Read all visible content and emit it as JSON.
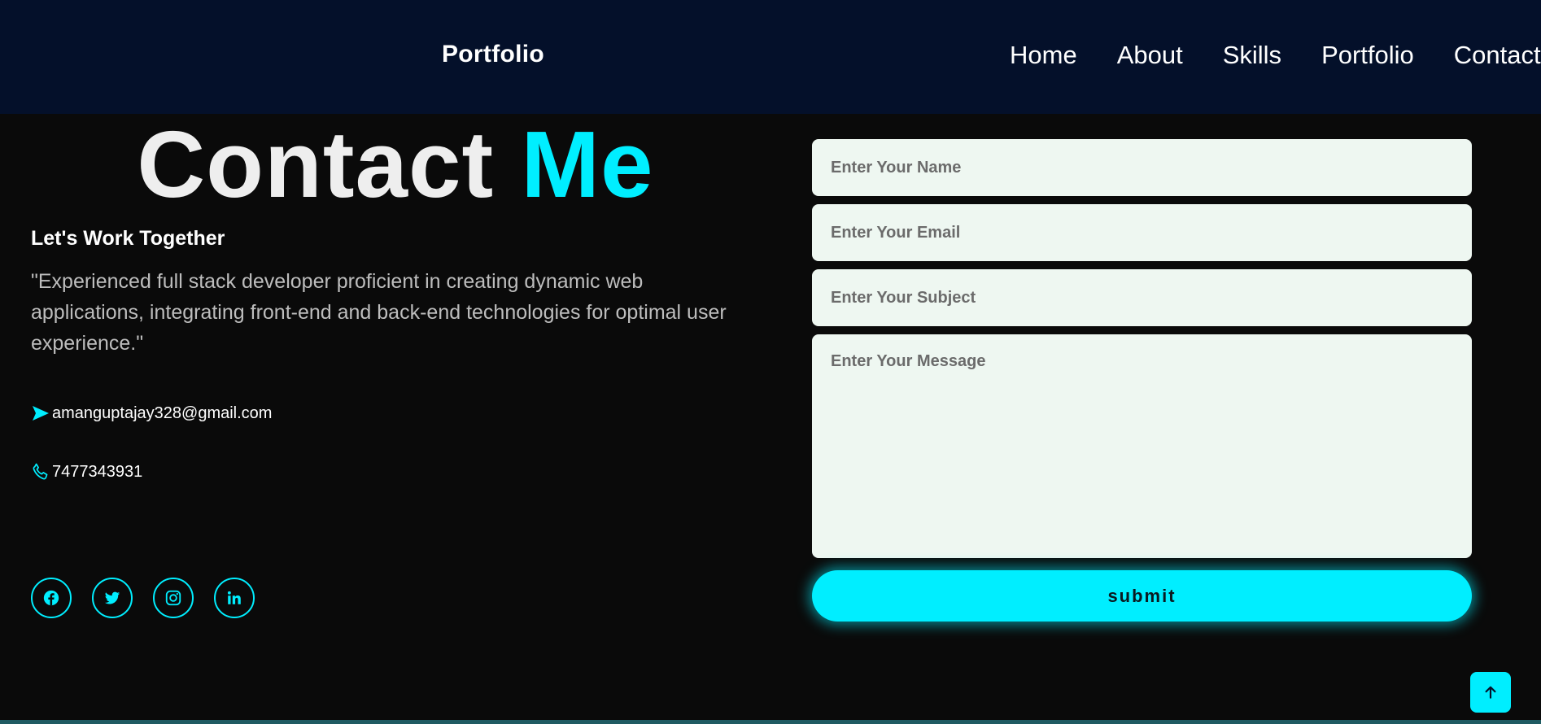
{
  "navbar": {
    "brand": "Portfolio",
    "links": [
      {
        "label": "Home"
      },
      {
        "label": "About"
      },
      {
        "label": "Skills"
      },
      {
        "label": "Portfolio"
      },
      {
        "label": "Contact"
      }
    ]
  },
  "contact": {
    "title_part1": "Contact",
    "title_part2": "Me",
    "subheading": "Let's Work Together",
    "description": "\"Experienced full stack developer proficient in creating dynamic web applications, integrating front-end and back-end technologies for optimal user experience.\"",
    "email": {
      "icon": "send-icon",
      "value": "amanguptajay328@gmail.com"
    },
    "phone": {
      "icon": "phone-icon",
      "value": "7477343931"
    },
    "socials": [
      {
        "icon": "facebook-icon"
      },
      {
        "icon": "twitter-icon"
      },
      {
        "icon": "instagram-icon"
      },
      {
        "icon": "linkedin-icon"
      }
    ]
  },
  "form": {
    "name_placeholder": "Enter Your Name",
    "email_placeholder": "Enter Your Email",
    "subject_placeholder": "Enter Your Subject",
    "message_placeholder": "Enter Your Message",
    "submit_label": "submit"
  },
  "scroll_top": {
    "icon": "arrow-up-icon"
  },
  "colors": {
    "accent": "#00eeff",
    "navbar_bg": "#04102a",
    "page_bg": "#0a0a0a",
    "field_bg": "#eef7f1"
  }
}
